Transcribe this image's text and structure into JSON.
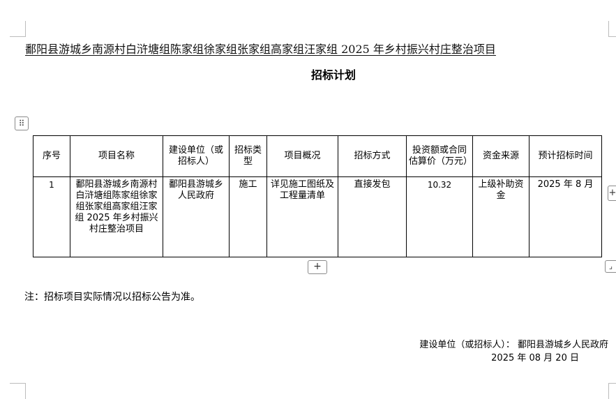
{
  "document": {
    "title": "鄱阳县游城乡南源村白浒塘组陈家组徐家组张家组高家组汪家组 2025 年乡村振兴村庄整治项目",
    "subtitle": "招标计划"
  },
  "controls": {
    "table_handle_glyph": "⠿",
    "add_row_glyph": "+",
    "side_add_glyph": "+",
    "resize_glyph": "⌟"
  },
  "table": {
    "headers": [
      "序号",
      "项目名称",
      "建设单位（或招标人）",
      "招标类型",
      "项目概况",
      "招标方式",
      "投资额或合同估算价（万元）",
      "资金来源",
      "预计招标时间"
    ],
    "rows": [
      {
        "index": "1",
        "project_name": "鄱阳县游城乡南源村白浒塘组陈家组徐家组张家组高家组汪家组 2025 年乡村振兴村庄整治项目",
        "unit": "鄱阳县游城乡人民政府",
        "type": "施工",
        "overview": "详见施工图纸及工程量清单",
        "method": "直接发包",
        "amount": "10.32",
        "fund_source": "上级补助资金",
        "time": "2025 年 8 月"
      }
    ]
  },
  "note": "注：招标项目实际情况以招标公告为准。",
  "signature": {
    "unit": "建设单位（或招标人）： 鄱阳县游城乡人民政府",
    "date": "2025 年 08 月 20 日"
  }
}
